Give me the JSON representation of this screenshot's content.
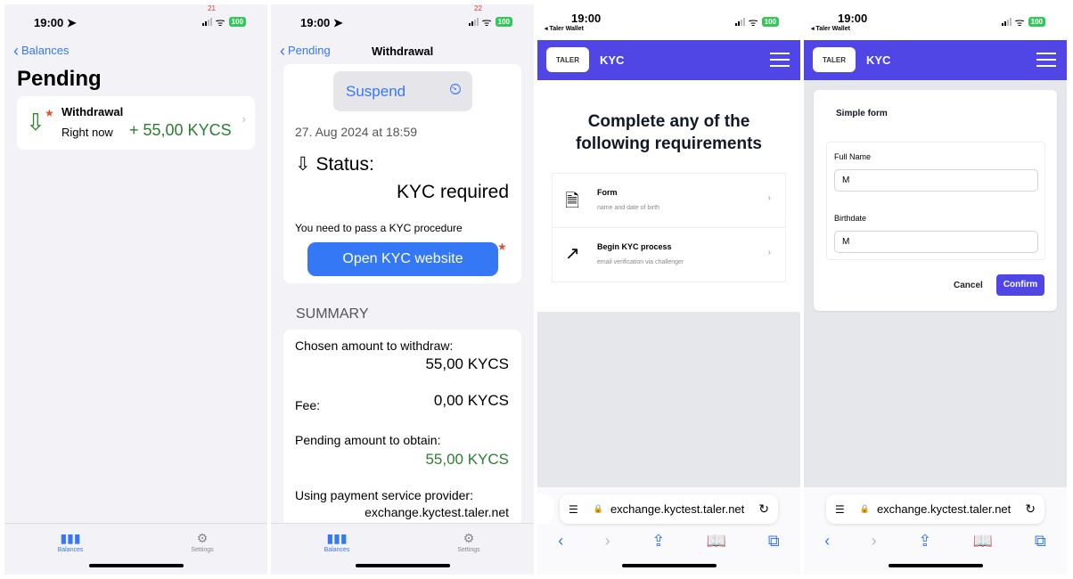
{
  "status_bar": {
    "time": "19:00",
    "battery": "100"
  },
  "screen1": {
    "badge": "21",
    "back": "Balances",
    "title": "Pending",
    "item": {
      "title": "Withdrawal",
      "when": "Right now",
      "amount": "+ 55,00 KYCS"
    },
    "tabs": [
      {
        "label": "Balances",
        "icon": "chart-bars-icon"
      },
      {
        "label": "Settings",
        "icon": "settings-icon"
      }
    ]
  },
  "screen2": {
    "badge": "22",
    "back": "Pending",
    "title": "Withdrawal",
    "suspend": "Suspend",
    "date": "27. Aug 2024 at 18:59",
    "status_label": "Status:",
    "status_value": "KYC required",
    "kyc_note": "You need to pass a KYC procedure",
    "open_kyc": "Open KYC website",
    "summary_header": "SUMMARY",
    "chosen_label": "Chosen amount to withdraw:",
    "chosen_value": "55,00 KYCS",
    "fee_label": "Fee:",
    "fee_value": "0,00 KYCS",
    "pending_label": "Pending amount to obtain:",
    "pending_value": "55,00 KYCS",
    "provider_label": "Using payment service provider:",
    "provider_value": "exchange.kyctest.taler.net",
    "tabs": [
      {
        "label": "Balances"
      },
      {
        "label": "Settings"
      }
    ]
  },
  "screen3": {
    "back_app": "◂ Taler Wallet",
    "logo": "TALER",
    "header": "KYC",
    "heading": "Complete any of the following requirements",
    "requirements": [
      {
        "title": "Form",
        "desc": "name and date of birth",
        "icon": "document-icon"
      },
      {
        "title": "Begin KYC process",
        "desc": "email verification via challenger",
        "icon": "external-link-icon"
      }
    ],
    "url": "exchange.kyctest.taler.net"
  },
  "screen4": {
    "back_app": "◂ Taler Wallet",
    "logo": "TALER",
    "header": "KYC",
    "form_title": "Simple form",
    "fields": [
      {
        "label": "Full Name",
        "value": "M"
      },
      {
        "label": "Birthdate",
        "value": "M"
      }
    ],
    "cancel": "Cancel",
    "confirm": "Confirm",
    "url": "exchange.kyctest.taler.net"
  }
}
